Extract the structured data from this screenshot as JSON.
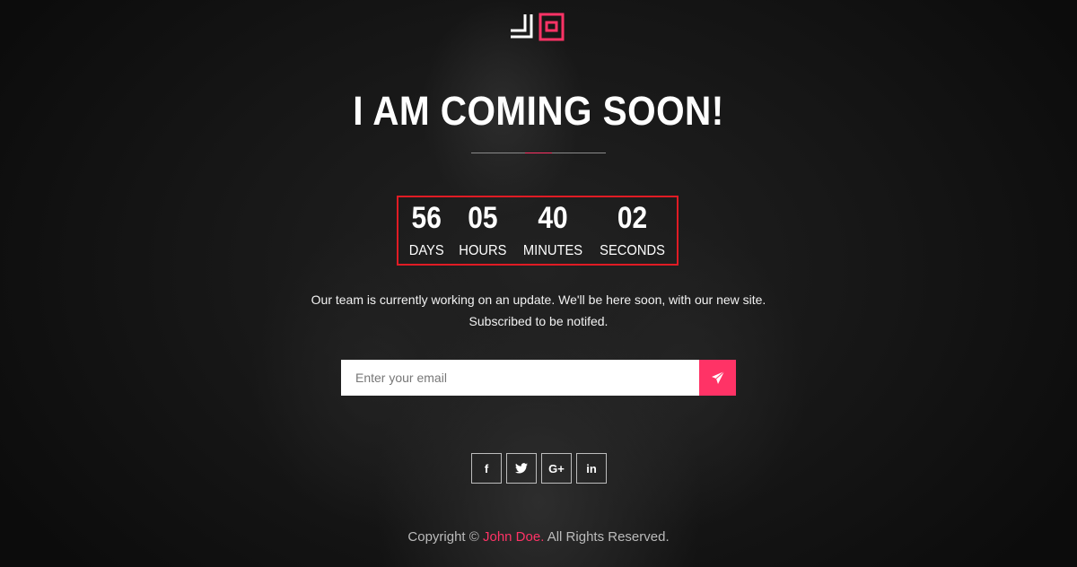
{
  "brand": {
    "logo_text": "JD",
    "accent_color": "#ff3366",
    "frame_color": "#e01b24"
  },
  "hero": {
    "title": "I AM COMING SOON!"
  },
  "countdown": [
    {
      "value": "56",
      "label": "DAYS"
    },
    {
      "value": "05",
      "label": "HOURS"
    },
    {
      "value": "40",
      "label": "MINUTES"
    },
    {
      "value": "02",
      "label": "SECONDS"
    }
  ],
  "description": {
    "line1": "Our team is currently working on an update. We'll be here soon, with our new site.",
    "line2": "Subscribed to be notifed."
  },
  "subscribe": {
    "placeholder": "Enter your email",
    "button_icon": "paper-plane-icon"
  },
  "social": [
    {
      "icon": "facebook-icon",
      "glyph": "f"
    },
    {
      "icon": "twitter-icon",
      "glyph": ""
    },
    {
      "icon": "google-plus-icon",
      "glyph": "G+"
    },
    {
      "icon": "linkedin-icon",
      "glyph": "in"
    }
  ],
  "footer": {
    "prefix": "Copyright ©",
    "name": "John Doe.",
    "suffix": "All Rights Reserved."
  }
}
